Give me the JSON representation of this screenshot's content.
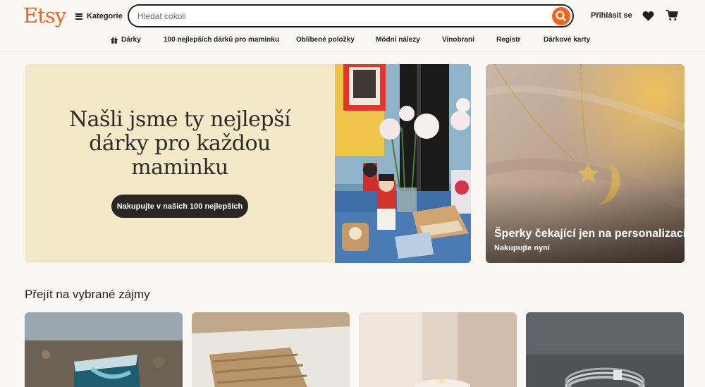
{
  "header": {
    "logo": "Etsy",
    "categories_label": "Kategorie",
    "search_placeholder": "Hledat cokoli",
    "signin_label": "Přihlásit se"
  },
  "nav": {
    "items": [
      "Dárky",
      "100 nejlepších dárků pro maminku",
      "Oblíbené položky",
      "Módní nálezy",
      "Vinobraní",
      "Registr",
      "Dárkové karty"
    ]
  },
  "hero": {
    "title": "Našli jsme ty nejlepší dárky pro každou maminku",
    "button_label": "Nakupujte v našich 100 nejlepších"
  },
  "promo": {
    "title": "Šperky čekající jen na personalizaci",
    "subtitle": "Nakupujte nyní"
  },
  "interests": {
    "section_title": "Přejít na vybrané zájmy"
  },
  "colors": {
    "brand": "#f1641e",
    "hero_bg": "#f3e8c8",
    "button_dark": "#2b2523",
    "page_bg": "#faf8f5"
  },
  "icons": [
    "hamburger-icon",
    "search-icon",
    "heart-icon",
    "cart-icon",
    "gift-icon"
  ]
}
